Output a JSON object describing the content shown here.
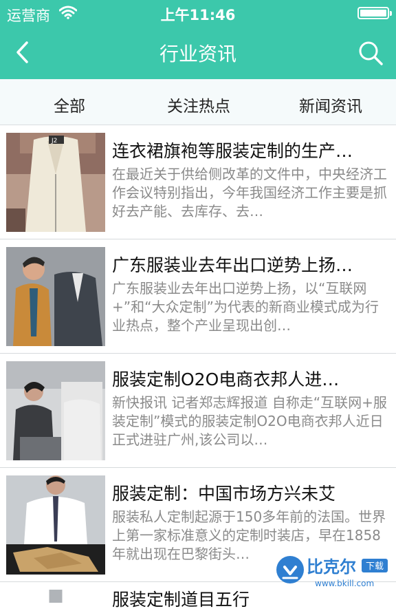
{
  "status_bar": {
    "carrier": "运营商",
    "time": "上午11:46"
  },
  "nav": {
    "title": "行业资讯"
  },
  "tabs": [
    "全部",
    "关注热点",
    "新闻资讯"
  ],
  "articles": [
    {
      "title": "连衣裙旗袍等服装定制的生产…",
      "summary": "在最近关于供给侧改革的文件中，中央经济工作会议特别指出，今年我国经济工作主要是抓好去产能、去库存、去…",
      "thumb": {
        "tag": "J2"
      }
    },
    {
      "title": "广东服装业去年出口逆势上扬…",
      "summary": "广东服装业去年出口逆势上扬，以“互联网+”和“大众定制”为代表的新商业模式成为行业热点，整个产业呈现出创…",
      "thumb": {}
    },
    {
      "title": "服装定制O2O电商衣邦人进…",
      "summary": "新快报讯 记者郑志辉报道 自称走“互联网+服装定制”模式的服装定制O2O电商衣邦人近日正式进驻广州,该公司以…",
      "thumb": {}
    },
    {
      "title": "服装定制：中国市场方兴未艾",
      "summary": "服装私人定制起源于150多年前的法国。世界上第一家标准意义的定制时装店，早在1858年就出现在巴黎街头…",
      "thumb": {}
    },
    {
      "title": "服装定制道目五行",
      "summary": "",
      "thumb": {}
    }
  ],
  "watermark": {
    "brand": "比克尔",
    "badge": "下载",
    "url": "www.bkill.com"
  }
}
